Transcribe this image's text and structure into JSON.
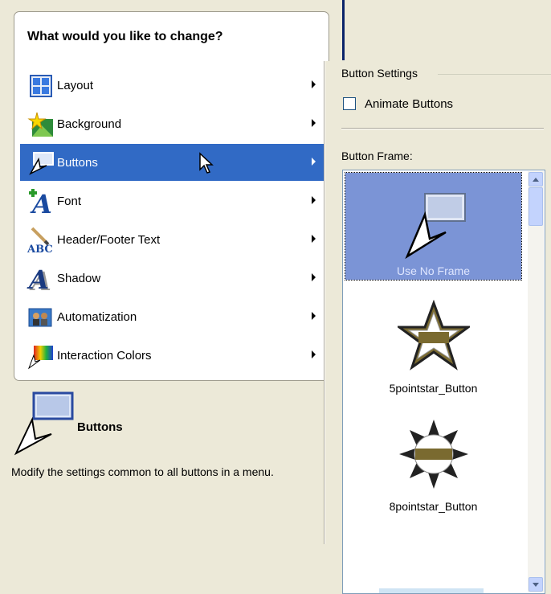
{
  "menu": {
    "title": "What would you like to change?",
    "items": [
      {
        "label": "Layout",
        "icon": "layout-icon"
      },
      {
        "label": "Background",
        "icon": "background-icon"
      },
      {
        "label": "Buttons",
        "icon": "buttons-icon",
        "selected": true
      },
      {
        "label": "Font",
        "icon": "font-icon"
      },
      {
        "label": "Header/Footer Text",
        "icon": "header-footer-icon"
      },
      {
        "label": "Shadow",
        "icon": "shadow-icon"
      },
      {
        "label": "Automatization",
        "icon": "automatization-icon"
      },
      {
        "label": "Interaction Colors",
        "icon": "interaction-colors-icon"
      }
    ]
  },
  "description": {
    "title": "Buttons",
    "text": "Modify the settings common to all buttons in a menu."
  },
  "settings": {
    "group_label": "Button Settings",
    "animate_label": "Animate Buttons",
    "animate_checked": false,
    "frame_label": "Button Frame:",
    "frames": [
      {
        "label": "Use No Frame",
        "selected": true
      },
      {
        "label": "5pointstar_Button"
      },
      {
        "label": "8pointstar_Button"
      }
    ]
  },
  "colors": {
    "selection": "#316AC5",
    "list_selection": "#7B94D6",
    "panel_bg": "#ECE9D8"
  }
}
